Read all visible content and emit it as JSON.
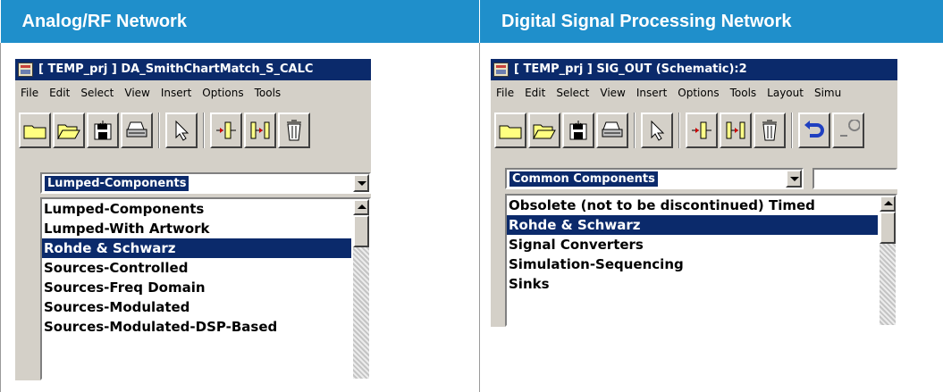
{
  "headers": {
    "left": "Analog/RF Network",
    "right": "Digital Signal Processing Network"
  },
  "left_window": {
    "title": "[ TEMP_prj ] DA_SmithChartMatch_S_CALC",
    "menu": [
      "File",
      "Edit",
      "Select",
      "View",
      "Insert",
      "Options",
      "Tools"
    ],
    "toolbar_icons": [
      "folder-icon",
      "open-folder-icon",
      "save-icon",
      "print-icon",
      "pointer-icon",
      "insert-pin-icon",
      "insert-wire-icon",
      "delete-icon"
    ],
    "palette_selected": "Lumped-Components",
    "palette_items": [
      {
        "label": "Lumped-Components",
        "selected": false
      },
      {
        "label": "Lumped-With Artwork",
        "selected": false
      },
      {
        "label": "Rohde & Schwarz",
        "selected": true
      },
      {
        "label": "Sources-Controlled",
        "selected": false
      },
      {
        "label": "Sources-Freq Domain",
        "selected": false
      },
      {
        "label": "Sources-Modulated",
        "selected": false
      },
      {
        "label": "Sources-Modulated-DSP-Based",
        "selected": false
      }
    ]
  },
  "right_window": {
    "title": "[ TEMP_prj ] SIG_OUT (Schematic):2",
    "menu": [
      "File",
      "Edit",
      "Select",
      "View",
      "Insert",
      "Options",
      "Tools",
      "Layout",
      "Simu"
    ],
    "toolbar_icons": [
      "folder-icon",
      "open-folder-icon",
      "save-icon",
      "print-icon",
      "pointer-icon",
      "insert-pin-icon",
      "insert-wire-icon",
      "delete-icon",
      "undo-icon",
      "extra-icon"
    ],
    "palette_selected": "Common Components",
    "palette_items": [
      {
        "label": "Obsolete (not to be discontinued) Timed",
        "selected": false
      },
      {
        "label": "Rohde & Schwarz",
        "selected": true
      },
      {
        "label": "Signal Converters",
        "selected": false
      },
      {
        "label": "Simulation-Sequencing",
        "selected": false
      },
      {
        "label": "Sinks",
        "selected": false
      }
    ]
  },
  "colors": {
    "header_bg": "#1f8fcb",
    "titlebar": "#0b2a6b",
    "highlight": "#0b2a6b",
    "window_face": "#d4d0c8"
  }
}
